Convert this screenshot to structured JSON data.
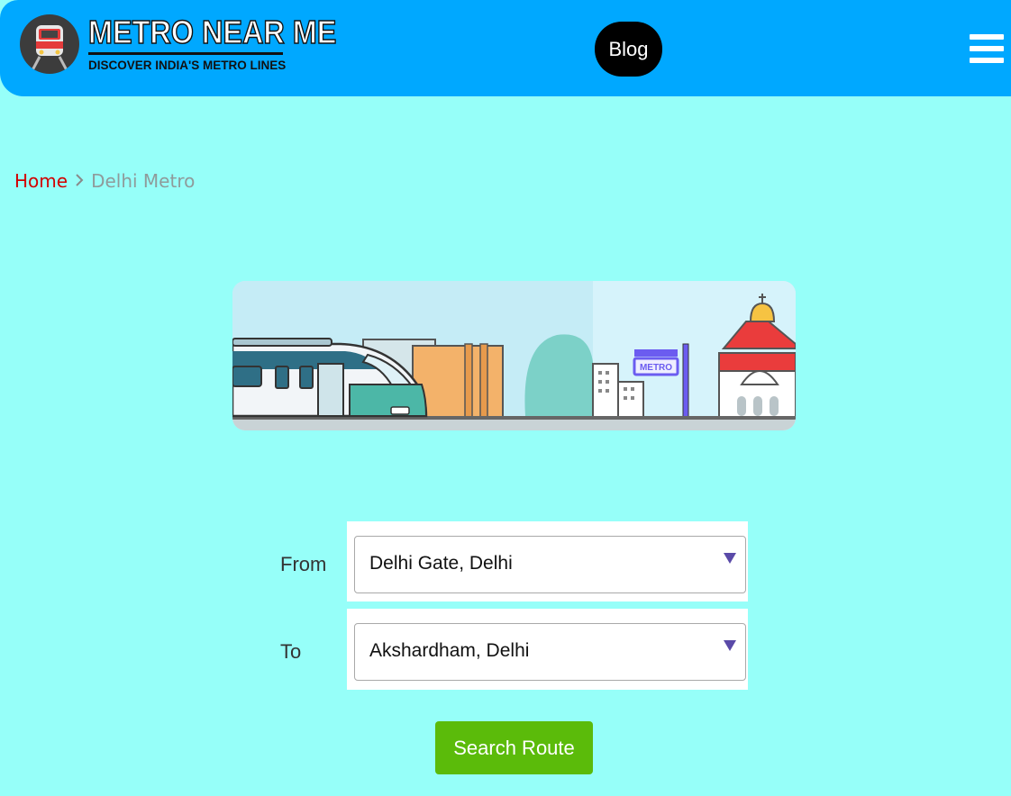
{
  "header": {
    "logo_title": "METRO NEAR ME",
    "logo_subtitle": "DISCOVER INDIA'S METRO LINES",
    "blog_label": "Blog",
    "menu_icon": "hamburger-icon",
    "accent_color": "#00a8ff"
  },
  "breadcrumb": {
    "home": "Home",
    "separator_icon": "chevron-right-icon",
    "current": "Delhi Metro"
  },
  "banner": {
    "sign_text": "METRO"
  },
  "form": {
    "from_label": "From",
    "from_value": "Delhi Gate, Delhi",
    "to_label": "To",
    "to_value": "Akshardham, Delhi",
    "search_label": "Search Route",
    "button_color": "#5bbb0a"
  },
  "colors": {
    "page_bg": "#96fff9",
    "home_link": "#d20000"
  }
}
